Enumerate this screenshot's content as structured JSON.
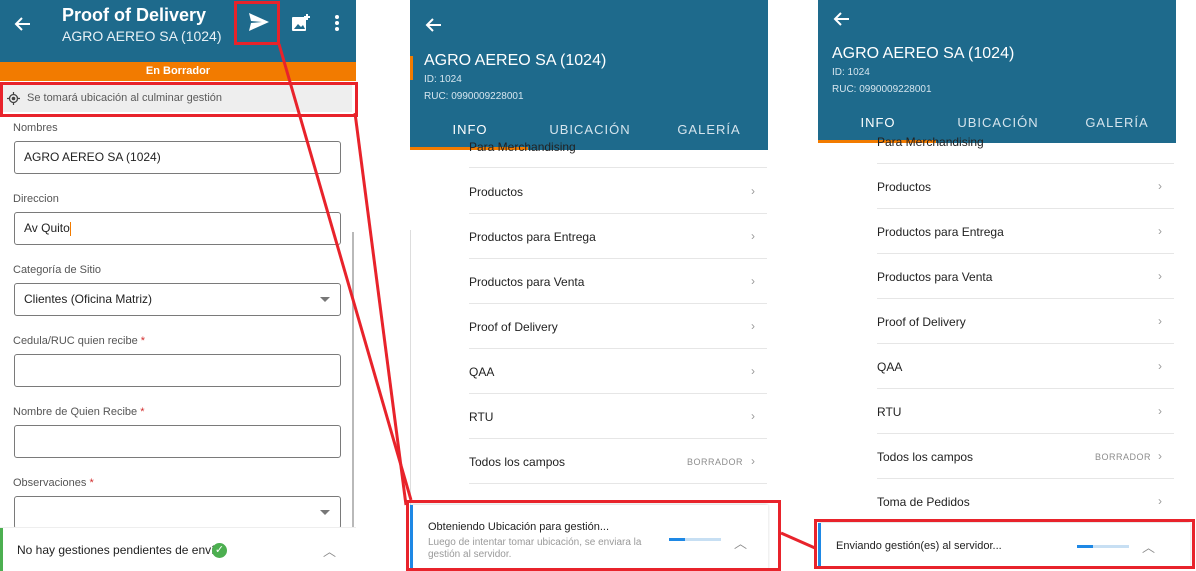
{
  "panel1": {
    "title": "Proof of Delivery",
    "subtitle": "AGRO AEREO SA (1024)",
    "icons": [
      "back-arrow-icon",
      "send-icon",
      "add-photo-icon",
      "more-vertical-icon"
    ],
    "status_strip": "En Borrador",
    "location_notice": "Se tomará ubicación al culminar gestión",
    "fields": [
      {
        "label": "Nombres",
        "required": false,
        "value": "AGRO AEREO SA (1024)",
        "dropdown": false
      },
      {
        "label": "Direccion",
        "required": false,
        "value": "Av Quito",
        "dropdown": false
      },
      {
        "label": "Categoría de Sitio",
        "required": false,
        "value": "Clientes (Oficina Matriz)",
        "dropdown": true
      },
      {
        "label": "Cedula/RUC quien recibe",
        "required": true,
        "value": "",
        "dropdown": false
      },
      {
        "label": "Nombre de Quien Recibe",
        "required": true,
        "value": "",
        "dropdown": false
      },
      {
        "label": "Observaciones",
        "required": true,
        "value": "",
        "dropdown": true
      }
    ],
    "required_mark": "*",
    "footer": {
      "text": "No hay gestiones pendientes de envío",
      "colors": {
        "accent": "#4caf50"
      }
    }
  },
  "panel2": {
    "title": "AGRO AEREO SA (1024)",
    "id_line": "ID: 1024",
    "ruc_line": "RUC: 0990009228001",
    "tabs": [
      "INFO",
      "UBICACIÓN",
      "GALERÍA"
    ],
    "active_tab": "INFO",
    "partial_item": "Para Merchandising",
    "items": [
      {
        "label": "Productos",
        "tag": ""
      },
      {
        "label": "Productos para Entrega",
        "tag": ""
      },
      {
        "label": "Productos para Venta",
        "tag": ""
      },
      {
        "label": "Proof of Delivery",
        "tag": ""
      },
      {
        "label": "QAA",
        "tag": ""
      },
      {
        "label": "RTU",
        "tag": ""
      },
      {
        "label": "Todos los campos",
        "tag": "BORRADOR"
      }
    ],
    "snackbar": {
      "title": "Obteniendo Ubicación para gestión...",
      "detail_line1": "Luego de intentar tomar ubicación, se enviara la",
      "detail_line2": "gestión al servidor.",
      "progress": 0.3
    }
  },
  "panel3": {
    "title": "AGRO AEREO SA (1024)",
    "id_line": "ID: 1024",
    "ruc_line": "RUC: 0990009228001",
    "tabs": [
      "INFO",
      "UBICACIÓN",
      "GALERÍA"
    ],
    "active_tab": "INFO",
    "partial_item": "Para Merchandising",
    "items": [
      {
        "label": "Productos",
        "tag": ""
      },
      {
        "label": "Productos para Entrega",
        "tag": ""
      },
      {
        "label": "Productos para Venta",
        "tag": ""
      },
      {
        "label": "Proof of Delivery",
        "tag": ""
      },
      {
        "label": "QAA",
        "tag": ""
      },
      {
        "label": "RTU",
        "tag": ""
      },
      {
        "label": "Todos los campos",
        "tag": "BORRADOR"
      },
      {
        "label": "Toma de Pedidos",
        "tag": ""
      }
    ],
    "snackbar": {
      "title": "Enviando gestión(es) al servidor...",
      "progress": 0.3
    }
  },
  "colors": {
    "header": "#1e6a8c",
    "accent_orange": "#f27b00",
    "annotation_red": "#e8232b",
    "progress_blue": "#1e88e5"
  }
}
